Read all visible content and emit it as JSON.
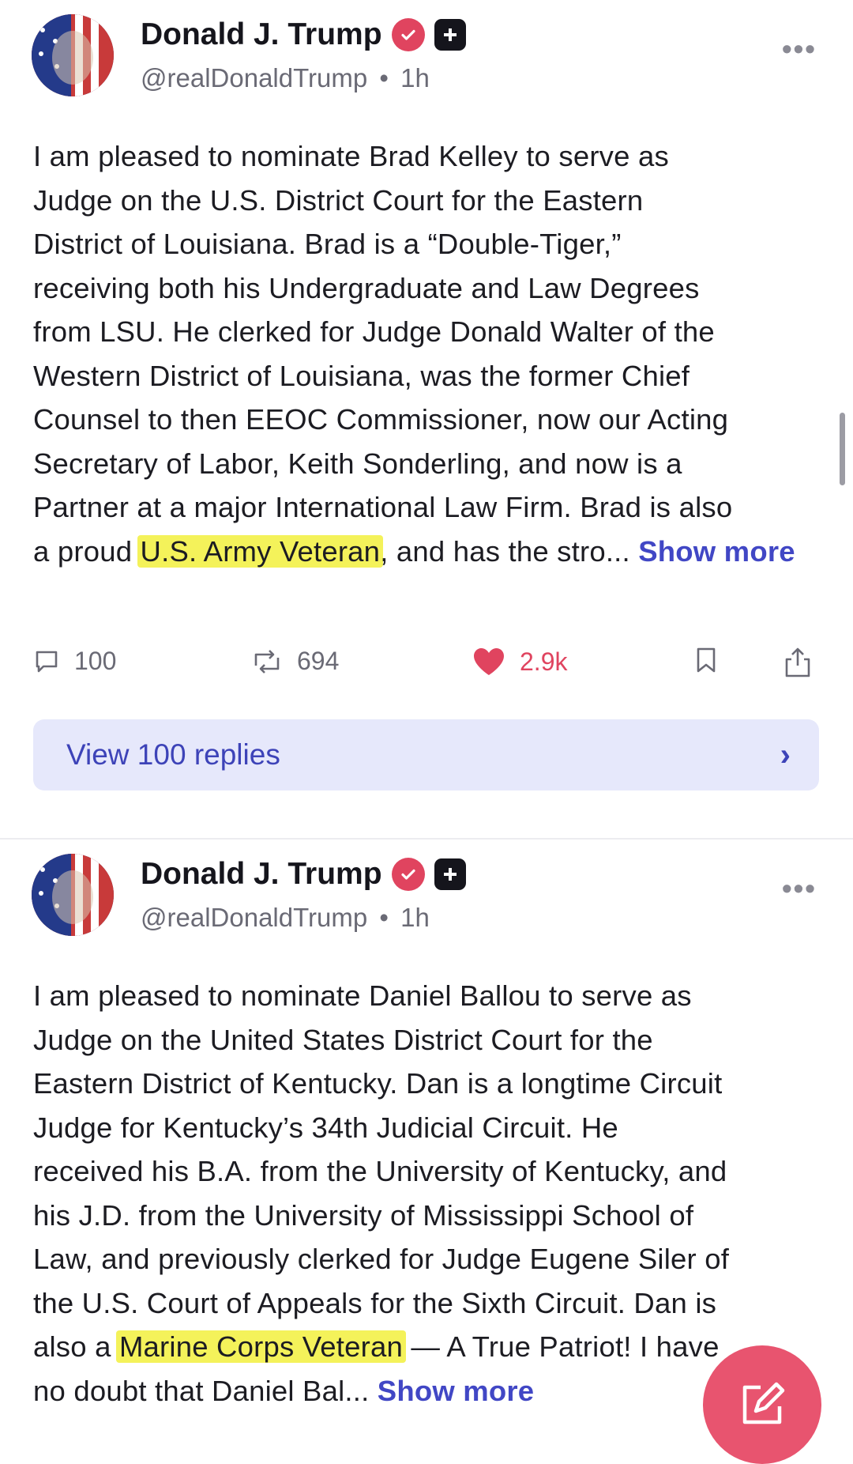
{
  "posts": [
    {
      "author": {
        "name": "Donald J. Trump",
        "handle": "@realDonaldTrump",
        "time": "1h"
      },
      "separator": "•",
      "text_lines": [
        "I am pleased to nominate Brad Kelley to serve as",
        "Judge on the U.S. District Court for the Eastern",
        "District of Louisiana. Brad is a “Double-Tiger,”",
        "receiving both his Undergraduate and Law Degrees",
        "from LSU. He clerked for Judge Donald Walter of the",
        "Western District of Louisiana, was the former Chief",
        "Counsel to then EEOC Commissioner, now our Acting",
        "Secretary of Labor, Keith Sonderling, and now is a",
        "Partner at a major International Law Firm. Brad is also"
      ],
      "line10_before": "a proud ",
      "line10_highlight": "U.S. Army Veteran",
      "line10_after": ", and has the stro... ",
      "show_more": "Show more",
      "stats": {
        "replies": "100",
        "reposts": "694",
        "likes": "2.9k"
      },
      "view_replies": "View 100 replies"
    },
    {
      "author": {
        "name": "Donald J. Trump",
        "handle": "@realDonaldTrump",
        "time": "1h"
      },
      "separator": "•",
      "text_lines": [
        "I am pleased to nominate Daniel Ballou to serve as",
        "Judge on the United States District Court for the",
        "Eastern District of Kentucky. Dan is a longtime Circuit",
        "Judge for Kentucky’s 34th Judicial Circuit. He",
        "received his B.A. from the University of Kentucky, and",
        "his J.D. from the University of Mississippi School of",
        "Law, and previously clerked for Judge Eugene Siler of",
        "the U.S. Court of Appeals for the Sixth Circuit. Dan is"
      ],
      "line9_before": "also a ",
      "line9_highlight": "Marine Corps Veteran",
      "line9_after": " — A True Patriot! I have",
      "line10": "no doubt that Daniel Bal... ",
      "show_more": "Show more"
    }
  ],
  "colors": {
    "accent": "#4147c5",
    "like": "#e0445f",
    "highlight": "#f4f25a",
    "fab": "#e8546f"
  },
  "icons": [
    "verified-badge-icon",
    "plus-badge-icon",
    "more-icon",
    "comment-icon",
    "repost-icon",
    "heart-icon",
    "bookmark-icon",
    "share-icon",
    "chevron-right-icon",
    "compose-icon"
  ]
}
